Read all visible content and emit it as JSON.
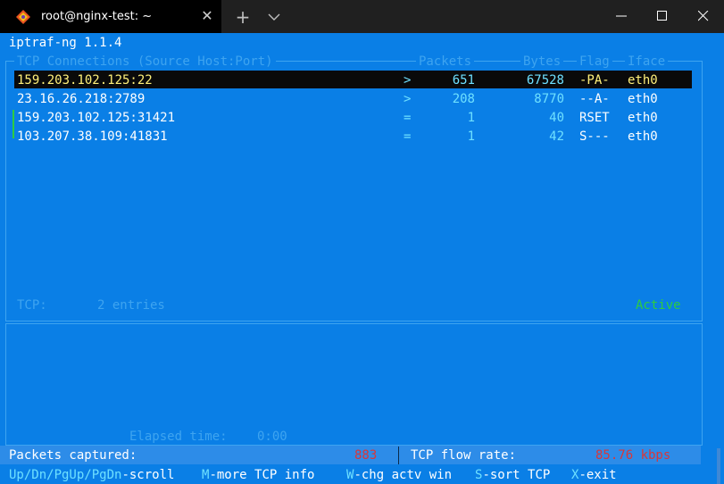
{
  "window": {
    "tab_title": "root@nginx-test: ~",
    "close_tab_glyph": "✕",
    "new_tab_glyph": "+"
  },
  "terminal": {
    "app_title": "iptraf-ng 1.1.4",
    "table_header": {
      "host": "TCP Connections (Source Host:Port)",
      "packets": "Packets",
      "bytes": "Bytes",
      "flag": "Flag",
      "iface": "Iface"
    },
    "rows": [
      {
        "host": "159.203.102.125:22",
        "dir": ">",
        "packets": "651",
        "bytes": "67528",
        "flag": "-PA-",
        "iface": "eth0"
      },
      {
        "host": "23.16.26.218:2789",
        "dir": ">",
        "packets": "208",
        "bytes": "8770",
        "flag": "--A-",
        "iface": "eth0"
      },
      {
        "host": "159.203.102.125:31421",
        "dir": "=",
        "packets": "1",
        "bytes": "40",
        "flag": "RSET",
        "iface": "eth0"
      },
      {
        "host": "103.207.38.109:41831",
        "dir": "=",
        "packets": "1",
        "bytes": "42",
        "flag": "S---",
        "iface": "eth0"
      }
    ],
    "tcp_label": "TCP:",
    "entries": "2 entries",
    "active": "Active",
    "elapsed_label": "Elapsed time:",
    "elapsed_value": "0:00",
    "packets_captured_label": "Packets captured:",
    "packets_captured_value": "883",
    "flow_rate_label": "TCP flow rate:",
    "flow_rate_value": "85.76 kbps",
    "help": [
      {
        "key": "Up/Dn/PgUp/PgDn",
        "text": "-scroll"
      },
      {
        "key": "M",
        "text": "-more TCP info"
      },
      {
        "key": "W",
        "text": "-chg actv win"
      },
      {
        "key": "S",
        "text": "-sort TCP"
      },
      {
        "key": "X",
        "text": "-exit"
      }
    ]
  },
  "colors": {
    "terminal_bg": "#0a7fe6",
    "highlight_bg": "#0a0a0a",
    "active_green": "#2ecc40",
    "value_red": "#d8373a"
  }
}
